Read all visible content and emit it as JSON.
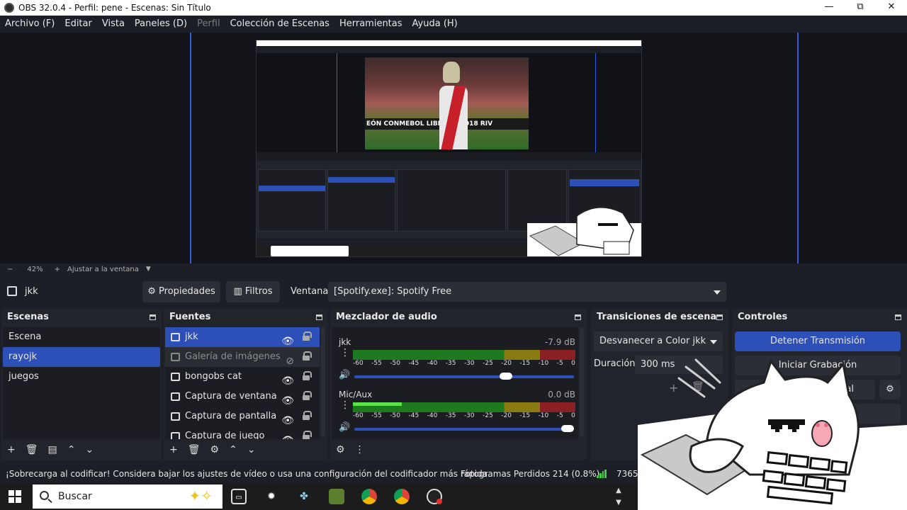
{
  "window": {
    "title": "OBS 32.0.4 - Perfil: pene - Escenas: Sin Título",
    "minimize": "—",
    "maximize": "⧉",
    "close": "✕"
  },
  "menu": {
    "items": [
      "Archivo (F)",
      "Editar",
      "Vista",
      "Paneles (D)",
      "Perfil",
      "Colección de Escenas",
      "Herramientas",
      "Ayuda (H)"
    ]
  },
  "preview": {
    "stadium_banner": "EÓN CONMEBOL LIBER    ES 2018  RIV"
  },
  "zoom": {
    "minus": "−",
    "value": "42%",
    "plus": "+",
    "fit_label": "Ajustar a la ventana"
  },
  "source_bar": {
    "current_source": "jkk",
    "properties_label": "Propiedades",
    "filters_label": "Filtros",
    "window_label": "Ventana",
    "window_value": "[Spotify.exe]: Spotify Free"
  },
  "scenes": {
    "title": "Escenas",
    "items": [
      "Escena",
      "rayojk",
      "juegos"
    ],
    "selected_index": 1
  },
  "sources": {
    "title": "Fuentes",
    "items": [
      "jkk",
      "Galería de imágenes",
      "bongobs cat",
      "Captura de ventana",
      "Captura de pantalla",
      "Captura de juego"
    ],
    "selected_index": 0,
    "hidden_index": 1
  },
  "mixer": {
    "title": "Mezclador de audio",
    "channels": [
      {
        "name": "jkk",
        "db": "-7.9 dB",
        "level": 0,
        "volume": 0.69
      },
      {
        "name": "Mic/Aux",
        "db": "0.0 dB",
        "level": 0.22,
        "volume": 0.97
      }
    ],
    "scale": [
      "-60",
      "-55",
      "-50",
      "-45",
      "-40",
      "-35",
      "-30",
      "-25",
      "-20",
      "-15",
      "-10",
      "-5",
      "0"
    ]
  },
  "transitions": {
    "title": "Transiciones de escena",
    "selected": "Desvanecer a Color jkk",
    "duration_label": "Duración",
    "duration_value": "300 ms"
  },
  "controls": {
    "title": "Controles",
    "stop_stream": "Detener Transmisión",
    "start_record": "Iniciar Grabación",
    "virtual_cam": "a Virtual"
  },
  "status": {
    "warning": "¡Sobrecarga al codificar! Considera bajar los ajustes de vídeo o usa una configuración del codificador más rápida.",
    "dropped_frames": "Fotogramas Perdidos 214 (0.8%)",
    "bitrate": "7365"
  },
  "taskbar": {
    "search_placeholder": "Buscar"
  },
  "colors": {
    "accent": "#2c4fb8",
    "panel": "#22242c",
    "background": "#1d1f26",
    "preview_border": "#2f5fd8"
  }
}
